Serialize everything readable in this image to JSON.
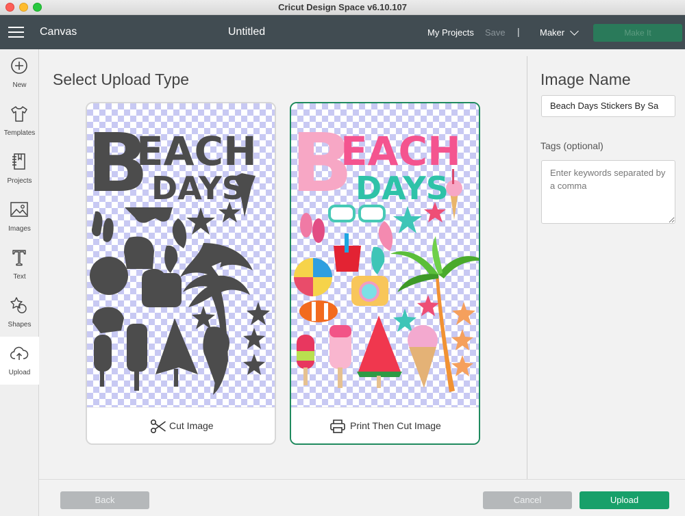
{
  "window": {
    "title": "Cricut Design Space  v6.10.107"
  },
  "header": {
    "canvas_label": "Canvas",
    "document_title": "Untitled",
    "my_projects": "My Projects",
    "save": "Save",
    "separator": "|",
    "machine": "Maker",
    "make_it": "Make It"
  },
  "sidebar": {
    "items": [
      {
        "label": "New",
        "icon": "plus-circle-icon"
      },
      {
        "label": "Templates",
        "icon": "tshirt-icon"
      },
      {
        "label": "Projects",
        "icon": "notebook-icon"
      },
      {
        "label": "Images",
        "icon": "image-icon"
      },
      {
        "label": "Text",
        "icon": "text-t-icon"
      },
      {
        "label": "Shapes",
        "icon": "shapes-icon"
      },
      {
        "label": "Upload",
        "icon": "cloud-upload-icon",
        "active": true
      }
    ]
  },
  "main": {
    "title": "Select Upload Type",
    "options": [
      {
        "label": "Cut Image",
        "icon": "scissors-icon",
        "selected": false
      },
      {
        "label": "Print Then Cut Image",
        "icon": "printer-icon",
        "selected": true
      }
    ],
    "preview_text": {
      "big_letter": "B",
      "line1": "EACH",
      "line2": "DAYS"
    }
  },
  "right_panel": {
    "image_name_label": "Image Name",
    "image_name_value": "Beach Days Stickers By Sa",
    "tags_label": "Tags (optional)",
    "tags_placeholder": "Enter keywords separated by a comma"
  },
  "footer": {
    "back": "Back",
    "cancel": "Cancel",
    "upload": "Upload"
  },
  "colors": {
    "header": "#414c52",
    "accent_green": "#18a06a",
    "selected_border": "#1f8a5e",
    "checker": "#c8c9f3"
  }
}
